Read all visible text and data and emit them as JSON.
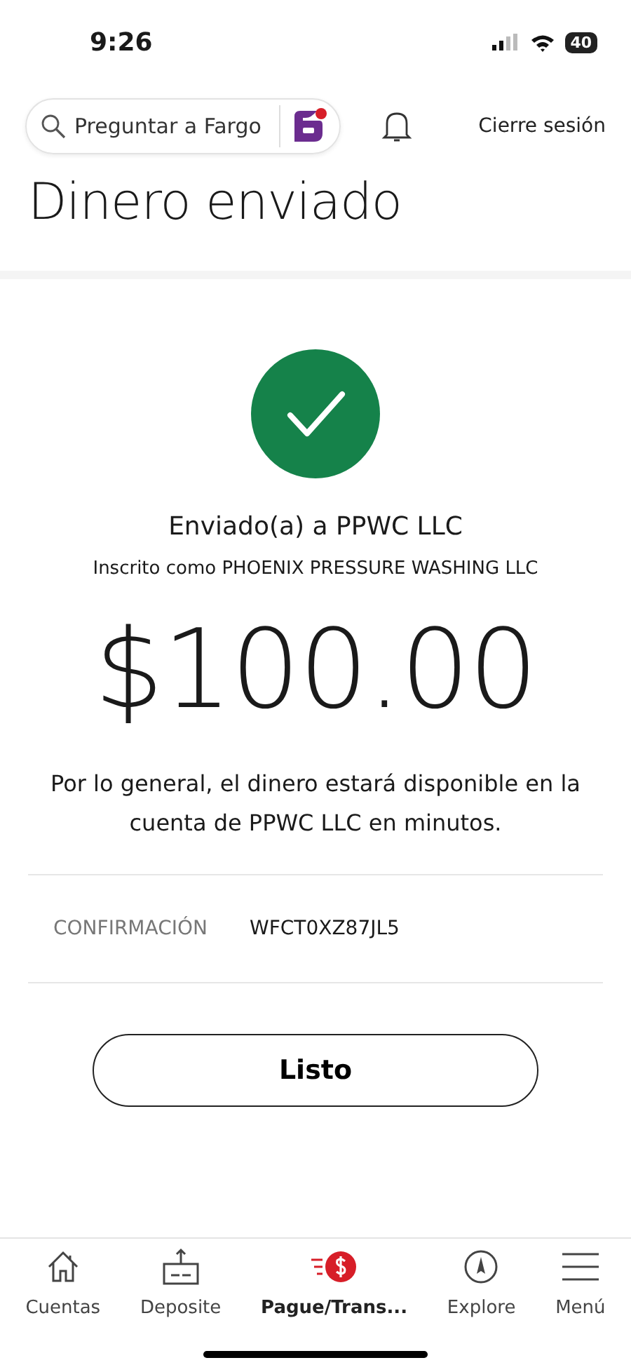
{
  "status_bar": {
    "time": "9:26",
    "battery": "40"
  },
  "header": {
    "search": {
      "placeholder": "Preguntar a Fargo"
    },
    "logout": "Cierre sesión"
  },
  "title": "Dinero enviado",
  "receipt": {
    "recipient": "Enviado(a) a PPWC LLC",
    "enrolled_as": "Inscrito como PHOENIX PRESSURE WASHING LLC",
    "amount": "$100.00",
    "note": "Por lo general, el dinero estará disponible en la cuenta de PPWC LLC en minutos.",
    "confirmation_label": "CONFIRMACIÓN",
    "confirmation_code": "WFCT0XZ87JL5"
  },
  "done_button": "Listo",
  "tab_bar": [
    {
      "kind": "home",
      "label": "Cuentas",
      "selected": false
    },
    {
      "kind": "deposit",
      "label": "Deposite",
      "selected": false
    },
    {
      "kind": "pay",
      "label": "Pague/Trans...",
      "selected": true
    },
    {
      "kind": "explore",
      "label": "Explore",
      "selected": false
    },
    {
      "kind": "menu",
      "label": "Menú",
      "selected": false
    }
  ]
}
